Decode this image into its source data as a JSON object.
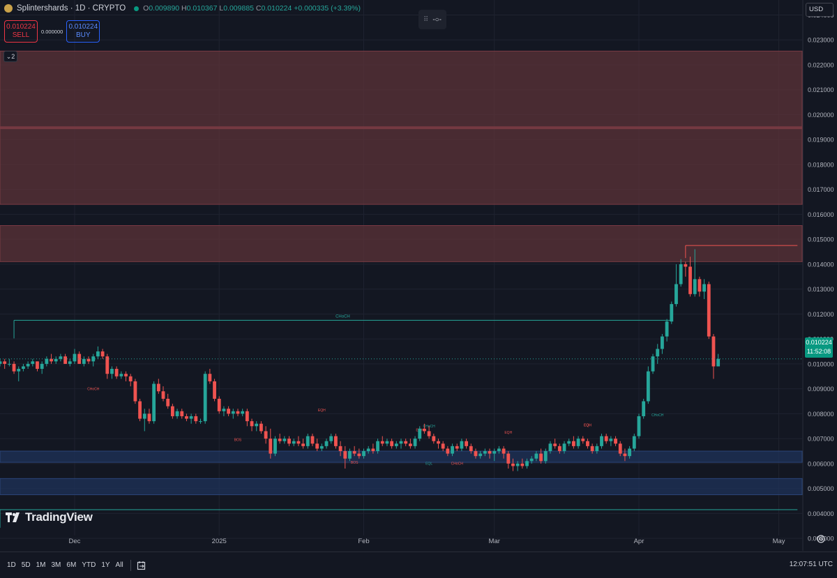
{
  "header": {
    "symbol_title": "Splintershards · 1D · CRYPTO",
    "ohlc": [
      {
        "label": "O",
        "value": "0.009890"
      },
      {
        "label": "H",
        "value": "0.010367"
      },
      {
        "label": "L",
        "value": "0.009885"
      },
      {
        "label": "C",
        "value": "0.010224"
      }
    ],
    "change": "+0.000335 (+3.39%)"
  },
  "trade": {
    "sell_price": "0.010224",
    "sell_label": "SELL",
    "buy_price": "0.010224",
    "buy_label": "BUY",
    "spread": "0.000000"
  },
  "indicator_toggle": "2",
  "currency": "USD",
  "last_price": {
    "value": "0.010224",
    "countdown": "11:52:08"
  },
  "branding": "TradingView",
  "time_ranges": [
    "1D",
    "5D",
    "1M",
    "3M",
    "6M",
    "YTD",
    "1Y",
    "All"
  ],
  "clock": "12:07:51 UTC",
  "colors": {
    "background": "#131722",
    "up": "#26a69a",
    "down": "#ef5350",
    "supply_zone": "#5c3338",
    "demand_zone": "#1f3359",
    "structure_line": "#26a69a"
  },
  "chart_data": {
    "type": "candlestick",
    "y_axis": {
      "ticks": [
        "0.024000",
        "0.023000",
        "0.022000",
        "0.021000",
        "0.020000",
        "0.019000",
        "0.018000",
        "0.017000",
        "0.016000",
        "0.015000",
        "0.014000",
        "0.013000",
        "0.012000",
        "0.011000",
        "0.010000",
        "0.009000",
        "0.008000",
        "0.007000",
        "0.006000",
        "0.005000",
        "0.004000",
        "0.003000"
      ],
      "range": [
        0.0025,
        0.0246
      ]
    },
    "x_axis": {
      "labels": [
        {
          "text": "Dec",
          "date": "2024-12-01"
        },
        {
          "text": "2025",
          "date": "2025-01-01"
        },
        {
          "text": "Feb",
          "date": "2025-02-01"
        },
        {
          "text": "Mar",
          "date": "2025-03-01"
        },
        {
          "text": "Apr",
          "date": "2025-04-01"
        },
        {
          "text": "May",
          "date": "2025-05-01"
        }
      ],
      "range": [
        "2024-11-15",
        "2025-05-06"
      ]
    },
    "start_date": "2024-11-15",
    "candles": [
      [
        0.01,
        0.0102,
        0.0099,
        0.0101
      ],
      [
        0.0101,
        0.0102,
        0.0098,
        0.01
      ],
      [
        0.01,
        0.0102,
        0.0099,
        0.01
      ],
      [
        0.01,
        0.0101,
        0.0096,
        0.0097
      ],
      [
        0.0097,
        0.0099,
        0.0093,
        0.0098
      ],
      [
        0.0098,
        0.01,
        0.0097,
        0.0099
      ],
      [
        0.0099,
        0.0101,
        0.0098,
        0.01
      ],
      [
        0.01,
        0.0102,
        0.0099,
        0.0101
      ],
      [
        0.0101,
        0.0101,
        0.0097,
        0.0098
      ],
      [
        0.0098,
        0.0101,
        0.0096,
        0.01
      ],
      [
        0.01,
        0.0103,
        0.0099,
        0.0102
      ],
      [
        0.0102,
        0.0104,
        0.01,
        0.0101
      ],
      [
        0.0101,
        0.0103,
        0.01,
        0.0102
      ],
      [
        0.0102,
        0.0104,
        0.0101,
        0.0103
      ],
      [
        0.0103,
        0.0104,
        0.01,
        0.01
      ],
      [
        0.01,
        0.0102,
        0.0099,
        0.0101
      ],
      [
        0.0101,
        0.0106,
        0.01,
        0.0104
      ],
      [
        0.0104,
        0.0105,
        0.01,
        0.01
      ],
      [
        0.01,
        0.0103,
        0.0099,
        0.0102
      ],
      [
        0.0102,
        0.0103,
        0.01,
        0.0101
      ],
      [
        0.0101,
        0.0104,
        0.0099,
        0.0103
      ],
      [
        0.0103,
        0.0107,
        0.0102,
        0.0105
      ],
      [
        0.0105,
        0.0106,
        0.0102,
        0.0103
      ],
      [
        0.0103,
        0.0104,
        0.0094,
        0.0096
      ],
      [
        0.0096,
        0.0099,
        0.0094,
        0.0098
      ],
      [
        0.0098,
        0.0099,
        0.0094,
        0.0095
      ],
      [
        0.0095,
        0.0097,
        0.0094,
        0.0096
      ],
      [
        0.0096,
        0.0097,
        0.0093,
        0.0095
      ],
      [
        0.0095,
        0.0096,
        0.0091,
        0.0093
      ],
      [
        0.0093,
        0.0094,
        0.0084,
        0.0085
      ],
      [
        0.0085,
        0.0086,
        0.0077,
        0.0078
      ],
      [
        0.0078,
        0.0082,
        0.0073,
        0.008
      ],
      [
        0.008,
        0.0082,
        0.0076,
        0.0077
      ],
      [
        0.0077,
        0.0093,
        0.0076,
        0.0092
      ],
      [
        0.0092,
        0.0094,
        0.0088,
        0.0089
      ],
      [
        0.0089,
        0.0091,
        0.0085,
        0.0086
      ],
      [
        0.0086,
        0.0088,
        0.0082,
        0.0083
      ],
      [
        0.0083,
        0.0084,
        0.0078,
        0.0079
      ],
      [
        0.0079,
        0.0082,
        0.0078,
        0.0081
      ],
      [
        0.0081,
        0.0082,
        0.0078,
        0.0079
      ],
      [
        0.0079,
        0.008,
        0.0077,
        0.0078
      ],
      [
        0.0078,
        0.008,
        0.0076,
        0.0079
      ],
      [
        0.0079,
        0.008,
        0.0076,
        0.0077
      ],
      [
        0.0077,
        0.0078,
        0.0076,
        0.0077
      ],
      [
        0.0077,
        0.0097,
        0.0076,
        0.0096
      ],
      [
        0.0096,
        0.0098,
        0.0092,
        0.0093
      ],
      [
        0.0093,
        0.0094,
        0.0085,
        0.0086
      ],
      [
        0.0086,
        0.0087,
        0.008,
        0.0081
      ],
      [
        0.0081,
        0.0083,
        0.0079,
        0.0082
      ],
      [
        0.0082,
        0.0083,
        0.0079,
        0.008
      ],
      [
        0.008,
        0.0082,
        0.0078,
        0.0081
      ],
      [
        0.0081,
        0.0082,
        0.0079,
        0.008
      ],
      [
        0.008,
        0.0082,
        0.0079,
        0.0081
      ],
      [
        0.0081,
        0.0082,
        0.0075,
        0.0077
      ],
      [
        0.0077,
        0.0078,
        0.0073,
        0.0075
      ],
      [
        0.0075,
        0.0077,
        0.0073,
        0.0076
      ],
      [
        0.0076,
        0.0077,
        0.0072,
        0.0073
      ],
      [
        0.0073,
        0.0075,
        0.0068,
        0.007
      ],
      [
        0.007,
        0.0074,
        0.0062,
        0.0064
      ],
      [
        0.0064,
        0.0071,
        0.0063,
        0.007
      ],
      [
        0.007,
        0.0072,
        0.0068,
        0.0069
      ],
      [
        0.0069,
        0.0071,
        0.0068,
        0.007
      ],
      [
        0.007,
        0.0071,
        0.0067,
        0.0068
      ],
      [
        0.0068,
        0.007,
        0.0067,
        0.0069
      ],
      [
        0.0069,
        0.0071,
        0.0067,
        0.0068
      ],
      [
        0.0068,
        0.007,
        0.0066,
        0.0067
      ],
      [
        0.0067,
        0.0072,
        0.0066,
        0.0071
      ],
      [
        0.0071,
        0.0072,
        0.0067,
        0.0068
      ],
      [
        0.0068,
        0.007,
        0.0065,
        0.0066
      ],
      [
        0.0066,
        0.0068,
        0.0065,
        0.0067
      ],
      [
        0.0067,
        0.007,
        0.0066,
        0.0069
      ],
      [
        0.0069,
        0.0072,
        0.0068,
        0.0071
      ],
      [
        0.0071,
        0.0072,
        0.0066,
        0.0067
      ],
      [
        0.0067,
        0.0069,
        0.0063,
        0.0065
      ],
      [
        0.0065,
        0.0067,
        0.0058,
        0.0062
      ],
      [
        0.0062,
        0.0066,
        0.0061,
        0.0065
      ],
      [
        0.0065,
        0.0067,
        0.0063,
        0.0064
      ],
      [
        0.0064,
        0.0066,
        0.0062,
        0.0063
      ],
      [
        0.0063,
        0.0066,
        0.0062,
        0.0065
      ],
      [
        0.0065,
        0.0067,
        0.0064,
        0.0066
      ],
      [
        0.0066,
        0.0068,
        0.0064,
        0.0065
      ],
      [
        0.0065,
        0.007,
        0.0064,
        0.0069
      ],
      [
        0.0069,
        0.0071,
        0.0067,
        0.0068
      ],
      [
        0.0068,
        0.007,
        0.0067,
        0.0069
      ],
      [
        0.0069,
        0.007,
        0.0066,
        0.0067
      ],
      [
        0.0067,
        0.0069,
        0.0066,
        0.0068
      ],
      [
        0.0068,
        0.007,
        0.0066,
        0.0069
      ],
      [
        0.0069,
        0.007,
        0.0067,
        0.0068
      ],
      [
        0.0068,
        0.007,
        0.0066,
        0.0067
      ],
      [
        0.0067,
        0.0071,
        0.0066,
        0.007
      ],
      [
        0.007,
        0.0075,
        0.0069,
        0.0074
      ],
      [
        0.0074,
        0.0076,
        0.0072,
        0.0073
      ],
      [
        0.0073,
        0.0075,
        0.007,
        0.0071
      ],
      [
        0.0071,
        0.0072,
        0.0068,
        0.0069
      ],
      [
        0.0069,
        0.007,
        0.0066,
        0.0068
      ],
      [
        0.0068,
        0.0069,
        0.0065,
        0.0066
      ],
      [
        0.0066,
        0.0067,
        0.0063,
        0.0064
      ],
      [
        0.0064,
        0.0068,
        0.0063,
        0.0067
      ],
      [
        0.0067,
        0.0068,
        0.0065,
        0.0066
      ],
      [
        0.0066,
        0.007,
        0.0065,
        0.0069
      ],
      [
        0.0069,
        0.007,
        0.0066,
        0.0067
      ],
      [
        0.0067,
        0.0068,
        0.0064,
        0.0065
      ],
      [
        0.0065,
        0.0066,
        0.0062,
        0.0063
      ],
      [
        0.0063,
        0.0065,
        0.0062,
        0.0064
      ],
      [
        0.0064,
        0.0066,
        0.0063,
        0.0065
      ],
      [
        0.0065,
        0.0066,
        0.0062,
        0.0064
      ],
      [
        0.0064,
        0.0066,
        0.0061,
        0.0065
      ],
      [
        0.0065,
        0.0067,
        0.0064,
        0.0066
      ],
      [
        0.0066,
        0.0067,
        0.0062,
        0.0064
      ],
      [
        0.0064,
        0.0065,
        0.0058,
        0.006
      ],
      [
        0.006,
        0.0062,
        0.0057,
        0.0059
      ],
      [
        0.0059,
        0.0061,
        0.0057,
        0.006
      ],
      [
        0.006,
        0.0062,
        0.0058,
        0.0059
      ],
      [
        0.0059,
        0.0062,
        0.0058,
        0.0061
      ],
      [
        0.0061,
        0.0063,
        0.006,
        0.0062
      ],
      [
        0.0062,
        0.0065,
        0.0061,
        0.0064
      ],
      [
        0.0064,
        0.0066,
        0.006,
        0.0061
      ],
      [
        0.0061,
        0.0066,
        0.006,
        0.0065
      ],
      [
        0.0065,
        0.0069,
        0.0064,
        0.0068
      ],
      [
        0.0068,
        0.007,
        0.0066,
        0.0067
      ],
      [
        0.0067,
        0.0068,
        0.0064,
        0.0065
      ],
      [
        0.0065,
        0.0069,
        0.0064,
        0.0068
      ],
      [
        0.0068,
        0.007,
        0.0067,
        0.0069
      ],
      [
        0.0069,
        0.0071,
        0.0066,
        0.0067
      ],
      [
        0.0067,
        0.0071,
        0.0066,
        0.007
      ],
      [
        0.007,
        0.0071,
        0.0068,
        0.0069
      ],
      [
        0.0069,
        0.007,
        0.0066,
        0.0067
      ],
      [
        0.0067,
        0.0068,
        0.0064,
        0.0065
      ],
      [
        0.0065,
        0.0068,
        0.0064,
        0.0067
      ],
      [
        0.0067,
        0.0072,
        0.0066,
        0.0071
      ],
      [
        0.0071,
        0.0072,
        0.0068,
        0.0069
      ],
      [
        0.0069,
        0.0071,
        0.0067,
        0.007
      ],
      [
        0.007,
        0.0071,
        0.0067,
        0.0068
      ],
      [
        0.0068,
        0.0069,
        0.0063,
        0.0064
      ],
      [
        0.0064,
        0.0066,
        0.0061,
        0.0063
      ],
      [
        0.0063,
        0.0067,
        0.0062,
        0.0066
      ],
      [
        0.0066,
        0.0072,
        0.0065,
        0.0071
      ],
      [
        0.0071,
        0.008,
        0.007,
        0.0079
      ],
      [
        0.0079,
        0.0086,
        0.0078,
        0.0085
      ],
      [
        0.0085,
        0.0099,
        0.0084,
        0.0097
      ],
      [
        0.0097,
        0.0104,
        0.0096,
        0.0103
      ],
      [
        0.0103,
        0.0108,
        0.01,
        0.0106
      ],
      [
        0.0106,
        0.0112,
        0.0104,
        0.0111
      ],
      [
        0.0111,
        0.0118,
        0.0109,
        0.0117
      ],
      [
        0.0117,
        0.0125,
        0.0116,
        0.0124
      ],
      [
        0.0124,
        0.014,
        0.0123,
        0.0132
      ],
      [
        0.0132,
        0.0142,
        0.0131,
        0.014
      ],
      [
        0.014,
        0.0141,
        0.0135,
        0.0139
      ],
      [
        0.0139,
        0.0143,
        0.0127,
        0.0128
      ],
      [
        0.0128,
        0.0146,
        0.0127,
        0.0134
      ],
      [
        0.0134,
        0.0135,
        0.0127,
        0.0129
      ],
      [
        0.0129,
        0.0134,
        0.0126,
        0.0132
      ],
      [
        0.0132,
        0.0133,
        0.011,
        0.0111
      ],
      [
        0.0111,
        0.0112,
        0.0094,
        0.0099
      ],
      [
        0.0099,
        0.0104,
        0.0099,
        0.0102
      ]
    ],
    "zones": [
      {
        "type": "supply",
        "top": 0.02255,
        "bottom": 0.0164
      },
      {
        "type": "supply",
        "top": 0.01555,
        "bottom": 0.0141
      },
      {
        "type": "demand",
        "top": 0.0065,
        "bottom": 0.00605
      },
      {
        "type": "demand",
        "top": 0.0054,
        "bottom": 0.00475
      }
    ],
    "levels": [
      {
        "label": "CHoCH",
        "price": 0.01175,
        "from": "2024-11-18",
        "to": "2025-04-08"
      },
      {
        "label": "",
        "price": 0.01475,
        "from": "2025-04-11",
        "to": "2025-05-05"
      },
      {
        "label": "",
        "price": 0.00415,
        "from": "2024-11-15",
        "to": "2025-05-05"
      }
    ],
    "annotations": [
      "CHoCH",
      "BOS",
      "EQH",
      "BOS",
      "EQH",
      "CHoCH",
      "EQH",
      "EQL",
      "CHoCH",
      "EQH",
      "EQH",
      "CHoCH"
    ]
  }
}
